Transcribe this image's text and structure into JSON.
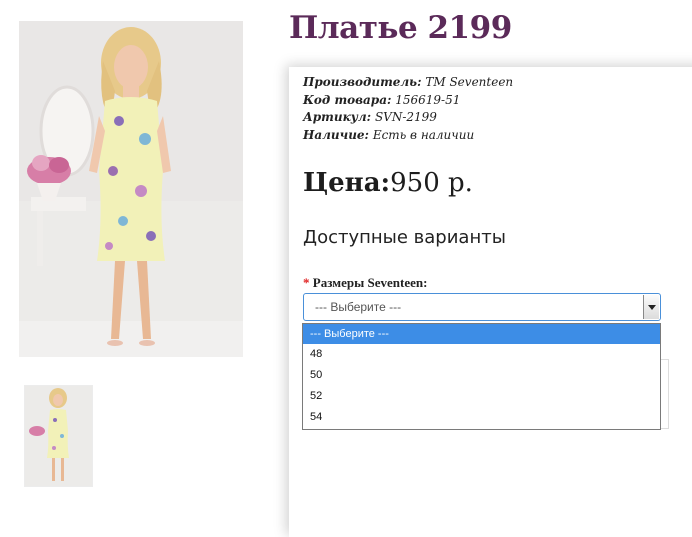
{
  "product": {
    "title": "Платье 2199",
    "manufacturer_label": "Производитель:",
    "manufacturer_value": "TM Seventeen",
    "code_label": "Код товара:",
    "code_value": "156619-51",
    "article_label": "Артикул:",
    "article_value": "SVN-2199",
    "availability_label": "Наличие:",
    "availability_value": "Есть в наличии",
    "price_label": "Цена:",
    "price_value": "950 р."
  },
  "options": {
    "heading": "Доступные варианты",
    "required_mark": "*",
    "size_label": "Размеры Seventeen:",
    "selected": "--- Выберите ---",
    "items": [
      "--- Выберите ---",
      "48",
      "50",
      "52",
      "54"
    ]
  },
  "colors": {
    "title": "#5b2a59",
    "highlight": "#3d8de6",
    "required": "#e02020"
  }
}
